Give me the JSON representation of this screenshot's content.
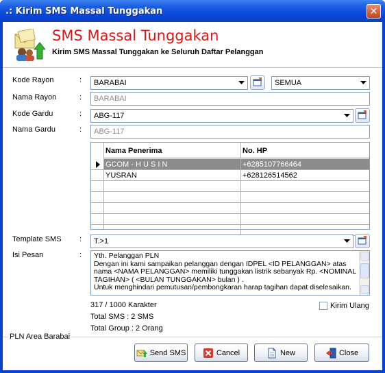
{
  "window": {
    "title": ".: Kirim SMS Massal Tunggakan",
    "close_glyph": "✕"
  },
  "header": {
    "title": "SMS Massal Tunggakan",
    "subtitle": "Kirim SMS Massal Tunggakan ke Seluruh Daftar Pelanggan",
    "icon": "sms-send-icon"
  },
  "form": {
    "colon": ":",
    "kode_rayon": {
      "label": "Kode Rayon",
      "value": "BARABAI",
      "filter_value": "SEMUA"
    },
    "nama_rayon": {
      "label": "Nama Rayon",
      "value": "BARABAI"
    },
    "kode_gardu": {
      "label": "Kode Gardu",
      "value": "ABG-117"
    },
    "nama_gardu": {
      "label": "Nama Gardu",
      "value": "ABG-117"
    },
    "template_sms": {
      "label": "Template SMS",
      "value": "T.>1"
    },
    "isi_pesan": {
      "label": "Isi Pesan",
      "lines": [
        "Yth. Pelanggan PLN",
        "Dengan ini kami sampaikan pelanggan dengan IDPEL <ID PELANGGAN> atas nama <NAMA PELANGGAN> memiliki tunggakan listrik sebanyak Rp. <NOMINAL TAGIHAN> ( <BULAN TUNGGAKAN> bulan ) .",
        "Untuk menghindari pemutusan/pembongkaran harap tagihan dapat diselesaikan."
      ]
    }
  },
  "grid": {
    "columns": [
      "Nama Penerima",
      "No. HP"
    ],
    "rows": [
      {
        "nama": "GCOM - H U S I N",
        "hp": "+6285107766464",
        "selected": true
      },
      {
        "nama": "YUSRAN",
        "hp": "+628126514562",
        "selected": false
      }
    ],
    "empty_rows": 5
  },
  "info": {
    "karakter": "317 / 1000 Karakter",
    "total_sms": "Total SMS : 2 SMS",
    "total_group": "Total Group : 2 Orang"
  },
  "kirim_ulang": {
    "label": "Kirim Ulang",
    "checked": false
  },
  "group_label": "PLN Area Barabai",
  "buttons": {
    "send": "Send SMS",
    "cancel": "Cancel",
    "new": "New",
    "close": "Close"
  },
  "colors": {
    "title_red": "#e01414",
    "titlebar_blue": "#0a46d8",
    "selected_row": "#8c8c8c"
  }
}
